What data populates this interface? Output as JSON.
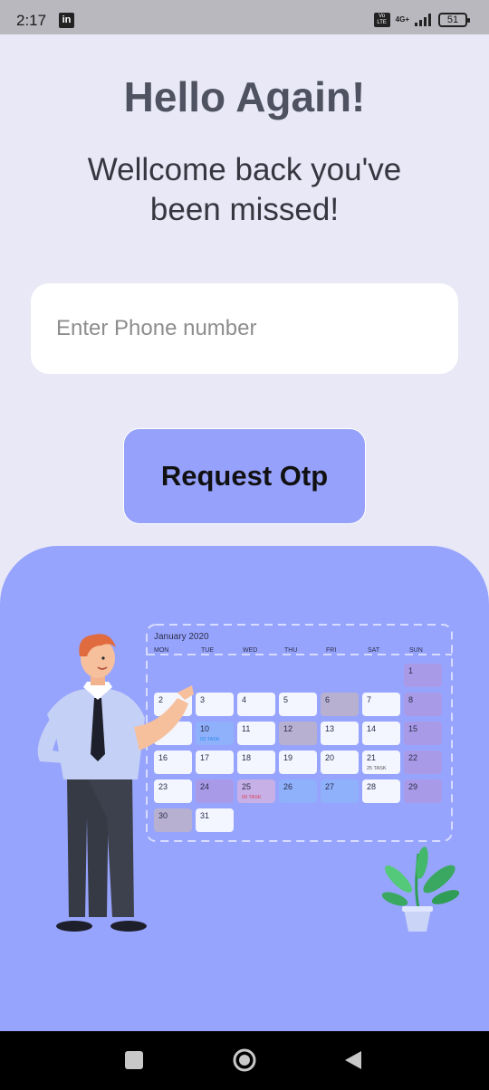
{
  "status_bar": {
    "time": "2:17",
    "app_icon": "linkedin-icon",
    "app_icon_text": "in",
    "volte_label": "Vo LTE",
    "network_label": "4G+",
    "battery_level": "51"
  },
  "title": "Hello Again!",
  "subtitle": "Wellcome back you've been missed!",
  "phone_input": {
    "placeholder": "Enter Phone number",
    "value": ""
  },
  "request_button": {
    "label": "Request Otp"
  },
  "calendar": {
    "month_label": "January 2020",
    "weekdays": [
      "MON",
      "TUE",
      "WED",
      "THU",
      "FRI",
      "SAT",
      "SUN"
    ],
    "days": [
      {
        "day": "1",
        "note": ""
      },
      {
        "day": "2",
        "note": ""
      },
      {
        "day": "3",
        "note": ""
      },
      {
        "day": "4",
        "note": ""
      },
      {
        "day": "5",
        "note": ""
      },
      {
        "day": "6",
        "note": ""
      },
      {
        "day": "7",
        "note": ""
      },
      {
        "day": "8",
        "note": ""
      },
      {
        "day": "9",
        "note": ""
      },
      {
        "day": "10",
        "note": "03 TASK"
      },
      {
        "day": "11",
        "note": ""
      },
      {
        "day": "12",
        "note": ""
      },
      {
        "day": "13",
        "note": ""
      },
      {
        "day": "14",
        "note": ""
      },
      {
        "day": "15",
        "note": ""
      },
      {
        "day": "16",
        "note": ""
      },
      {
        "day": "17",
        "note": ""
      },
      {
        "day": "18",
        "note": ""
      },
      {
        "day": "19",
        "note": ""
      },
      {
        "day": "20",
        "note": ""
      },
      {
        "day": "21",
        "note": "25 TASK"
      },
      {
        "day": "22",
        "note": ""
      },
      {
        "day": "23",
        "note": ""
      },
      {
        "day": "24",
        "note": ""
      },
      {
        "day": "25",
        "note": "09 TASK"
      },
      {
        "day": "26",
        "note": ""
      },
      {
        "day": "27",
        "note": ""
      },
      {
        "day": "28",
        "note": ""
      },
      {
        "day": "29",
        "note": ""
      },
      {
        "day": "30",
        "note": ""
      },
      {
        "day": "31",
        "note": ""
      }
    ]
  },
  "nav": {
    "recents_icon": "square-icon",
    "home_icon": "circle-home-icon",
    "back_icon": "triangle-back-icon"
  },
  "colors": {
    "background": "#e8e8f6",
    "accent": "#96a1fc",
    "panel": "#97a4fd"
  }
}
